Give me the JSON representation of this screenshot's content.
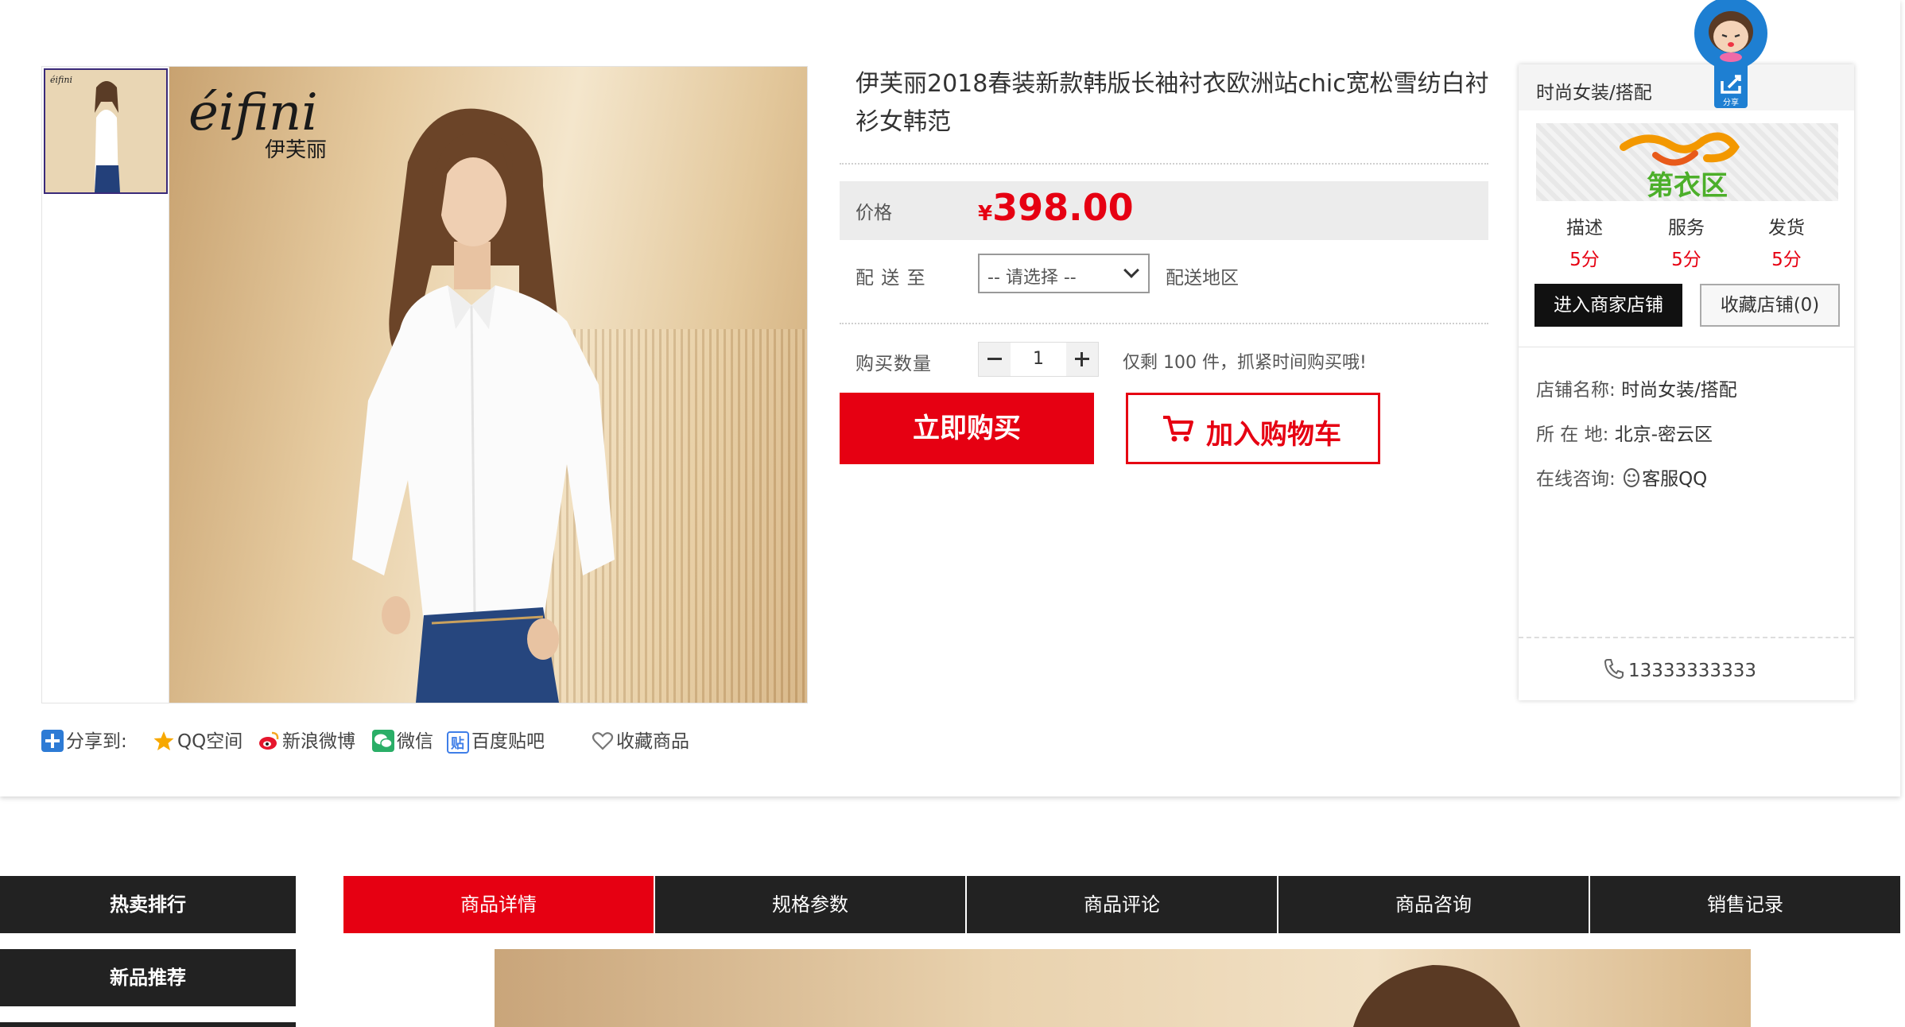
{
  "product": {
    "title": "伊芙丽2018春装新款韩版长袖衬衣欧洲站chic宽松雪纺白衬衫女韩范",
    "brand_logo_script": "éifini",
    "brand_logo_cn": "伊芙丽"
  },
  "price": {
    "label": "价格",
    "currency": "¥",
    "value": "398.00"
  },
  "shipping": {
    "label": "配 送 至",
    "select_value": "-- 请选择 --",
    "area_label": "配送地区"
  },
  "quantity": {
    "label": "购买数量",
    "value": "1",
    "stock_note": "仅剩 100 件，抓紧时间购买哦!"
  },
  "actions": {
    "buy_now": "立即购买",
    "add_cart": "加入购物车"
  },
  "share": {
    "label": "分享到:",
    "qzone": "QQ空间",
    "weibo": "新浪微博",
    "wechat": "微信",
    "tieba": "百度贴吧",
    "favorite": "收藏商品"
  },
  "store": {
    "header": "时尚女装/搭配",
    "logo_text": "第衣区",
    "ratings": [
      {
        "label": "描述",
        "score": "5分"
      },
      {
        "label": "服务",
        "score": "5分"
      },
      {
        "label": "发货",
        "score": "5分"
      }
    ],
    "enter_btn": "进入商家店铺",
    "fav_btn": "收藏店铺(0)",
    "name_label": "店铺名称:",
    "name_value": "时尚女装/搭配",
    "loc_label": "所 在 地:",
    "loc_value": "北京-密云区",
    "consult_label": "在线咨询:",
    "consult_value": "客服QQ",
    "phone": "13333333333"
  },
  "floating": {
    "share_label": "分享"
  },
  "sidebar": {
    "hot": "热卖排行",
    "new": "新品推荐"
  },
  "tabs": [
    "商品详情",
    "规格参数",
    "商品评论",
    "商品咨询",
    "销售记录"
  ],
  "colors": {
    "accent": "#e60012",
    "dark": "#222222"
  }
}
